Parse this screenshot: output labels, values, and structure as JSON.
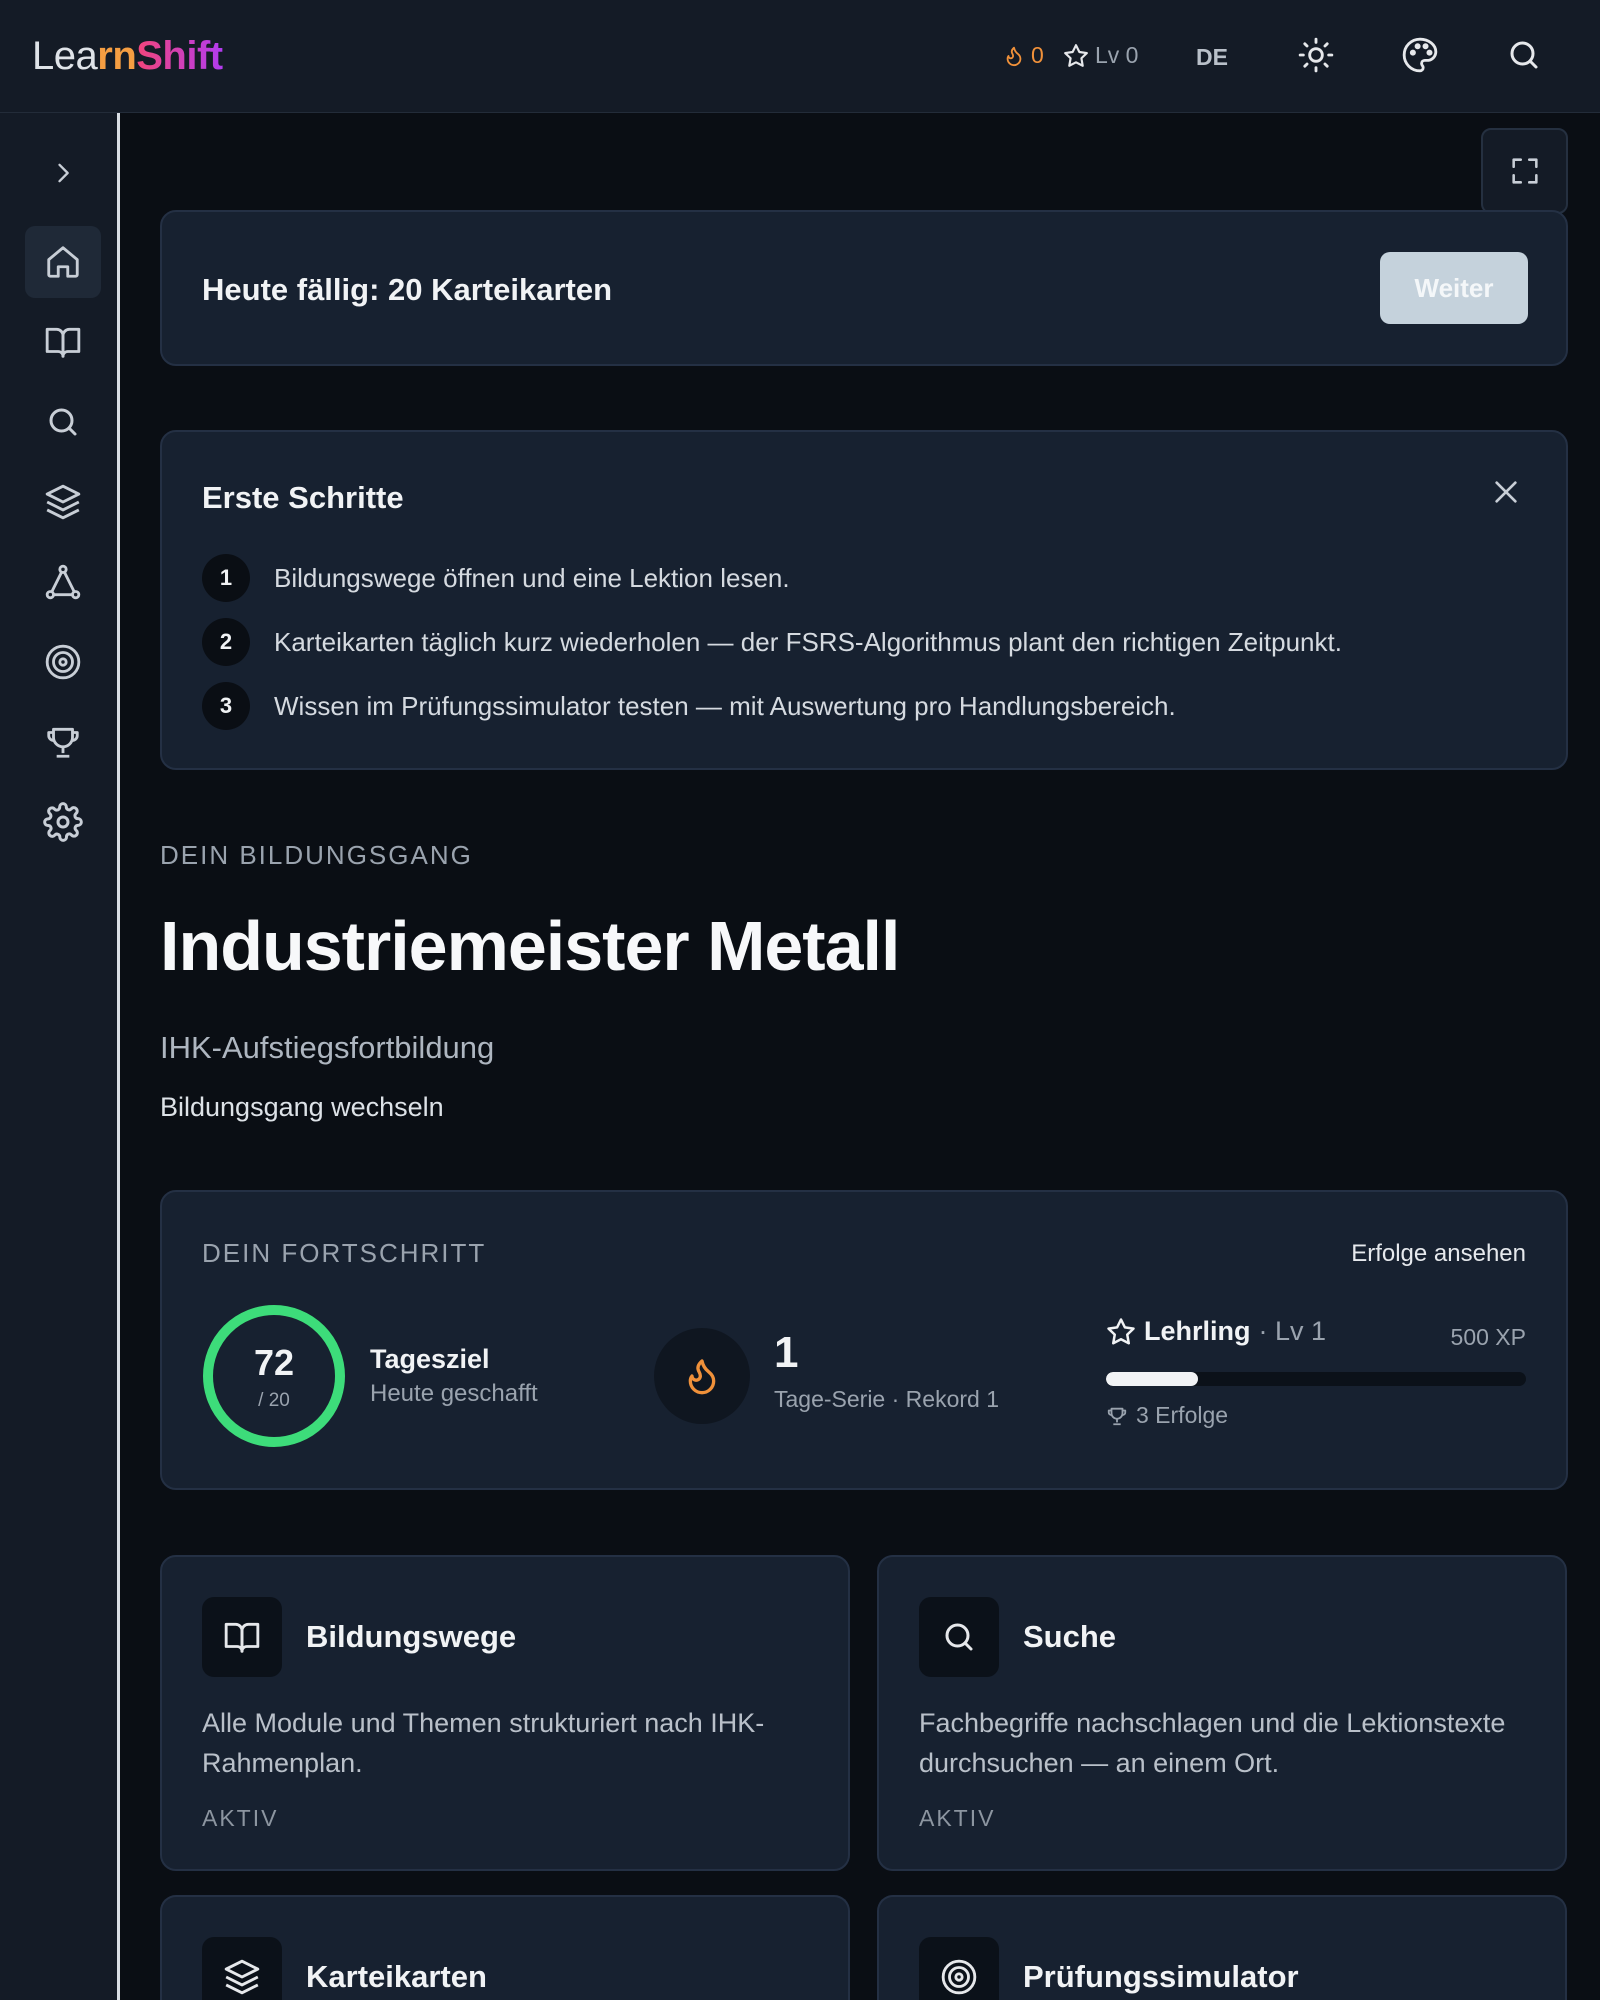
{
  "header": {
    "logo_part1": "Lea",
    "logo_part2": "rn",
    "logo_part3": "Shift",
    "streak_count": "0",
    "level": "Lv 0",
    "language": "DE"
  },
  "sidebar": {
    "items": [
      {
        "name": "expand",
        "icon": "chevron-right-icon"
      },
      {
        "name": "home",
        "icon": "home-icon",
        "active": true
      },
      {
        "name": "bildungswege",
        "icon": "book-open-icon"
      },
      {
        "name": "suche",
        "icon": "search-icon"
      },
      {
        "name": "karteikarten",
        "icon": "layers-icon"
      },
      {
        "name": "mindmap",
        "icon": "graph-icon"
      },
      {
        "name": "pruefungssimulator",
        "icon": "target-icon"
      },
      {
        "name": "erfolge",
        "icon": "trophy-icon"
      },
      {
        "name": "einstellungen",
        "icon": "gear-icon"
      }
    ]
  },
  "due": {
    "text": "Heute fällig: 20 Karteikarten",
    "button": "Weiter"
  },
  "steps": {
    "title": "Erste Schritte",
    "items": [
      {
        "num": "1",
        "text": "Bildungswege öffnen und eine Lektion lesen."
      },
      {
        "num": "2",
        "text": "Karteikarten täglich kurz wiederholen — der FSRS-Algorithmus plant den richtigen Zeitpunkt."
      },
      {
        "num": "3",
        "text": "Wissen im Prüfungssimulator testen — mit Auswertung pro Handlungsbereich."
      }
    ]
  },
  "course": {
    "label": "DEIN BILDUNGSGANG",
    "title": "Industriemeister Metall",
    "subtitle": "IHK-Aufstiegsfortbildung",
    "switch_link": "Bildungsgang wechseln"
  },
  "progress": {
    "label": "DEIN FORTSCHRITT",
    "link": "Erfolge ansehen",
    "ring_value": "72",
    "ring_sub": "/ 20",
    "ring_fraction": 1.0,
    "goal_title": "Tagesziel",
    "goal_sub": "Heute geschafft",
    "streak_value": "1",
    "streak_sub": "Tage-Serie · Rekord 1",
    "rank_name": "Lehrling",
    "rank_level": "· Lv 1",
    "xp": "500 XP",
    "xp_fraction": 0.22,
    "achievements": "3 Erfolge"
  },
  "features": [
    {
      "title": "Bildungswege",
      "desc": "Alle Module und Themen strukturiert nach IHK-Rahmenplan.",
      "status": "AKTIV",
      "icon": "book-open-icon"
    },
    {
      "title": "Suche",
      "desc": "Fachbegriffe nachschlagen und die Lektionstexte durchsuchen — an einem Ort.",
      "status": "AKTIV",
      "icon": "search-icon"
    },
    {
      "title": "Karteikarten",
      "icon": "layers-icon"
    },
    {
      "title": "Prüfungssimulator",
      "icon": "target-icon"
    }
  ],
  "colors": {
    "accent_green": "#3ddc7a",
    "accent_orange": "#f0913a",
    "background": "#0a0e14",
    "card": "#172130"
  }
}
